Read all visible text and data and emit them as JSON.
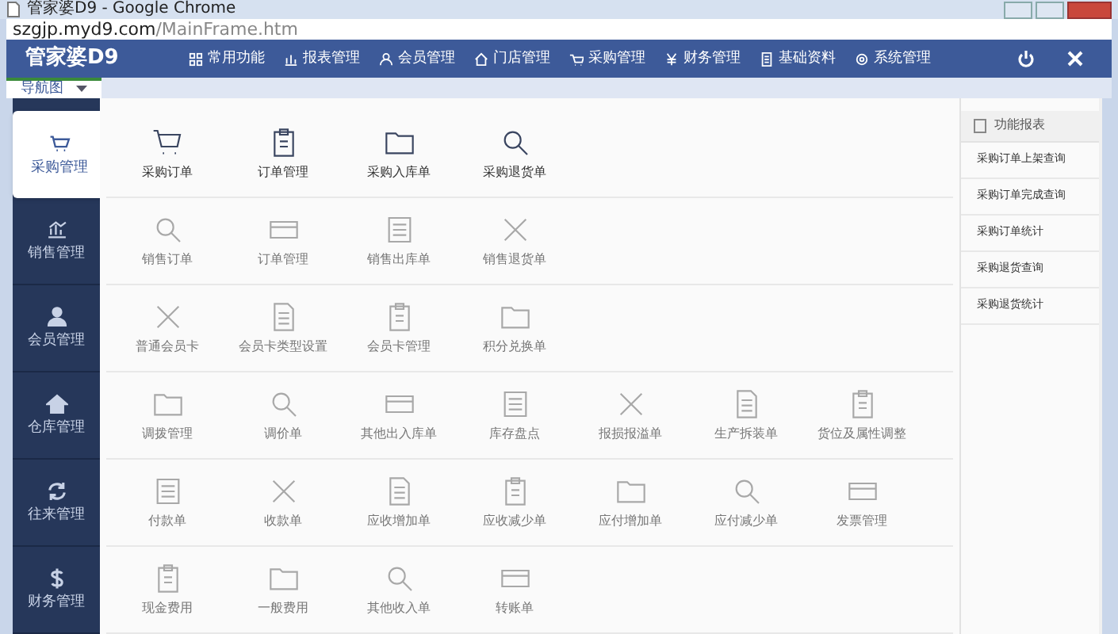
{
  "browser": {
    "title": "管家婆D9 - Google Chrome",
    "url_host": "szgjp.myd9.com",
    "url_path": "/MainFrame.htm"
  },
  "app": {
    "logo": "管家婆D9"
  },
  "top_menu": [
    "常用功能",
    "报表管理",
    "会员管理",
    "门店管理",
    "采购管理",
    "财务管理",
    "基础资料",
    "系统管理"
  ],
  "nav_tab": {
    "label": "导航图"
  },
  "sidebar": [
    {
      "label": "采购管理",
      "selected": true
    },
    {
      "label": "销售管理",
      "selected": false
    },
    {
      "label": "会员管理",
      "selected": false
    },
    {
      "label": "仓库管理",
      "selected": false
    },
    {
      "label": "往来管理",
      "selected": false
    },
    {
      "label": "财务管理",
      "selected": false
    }
  ],
  "rows": [
    [
      "采购订单",
      "订单管理",
      "采购入库单",
      "采购退货单"
    ],
    [
      "销售订单",
      "订单管理",
      "销售出库单",
      "销售退货单"
    ],
    [
      "普通会员卡",
      "会员卡类型设置",
      "会员卡管理",
      "积分兑换单"
    ],
    [
      "调拨管理",
      "调价单",
      "其他出入库单",
      "库存盘点",
      "报损报溢单",
      "生产拆装单",
      "货位及属性调整"
    ],
    [
      "付款单",
      "收款单",
      "应收增加单",
      "应收减少单",
      "应付增加单",
      "应付减少单",
      "发票管理"
    ],
    [
      "现金费用",
      "一般费用",
      "其他收入单",
      "转账单"
    ]
  ],
  "reports": {
    "title": "功能报表",
    "items": [
      "采购订单上架查询",
      "采购订单完成查询",
      "采购订单统计",
      "采购退货查询",
      "采购退货统计"
    ]
  }
}
